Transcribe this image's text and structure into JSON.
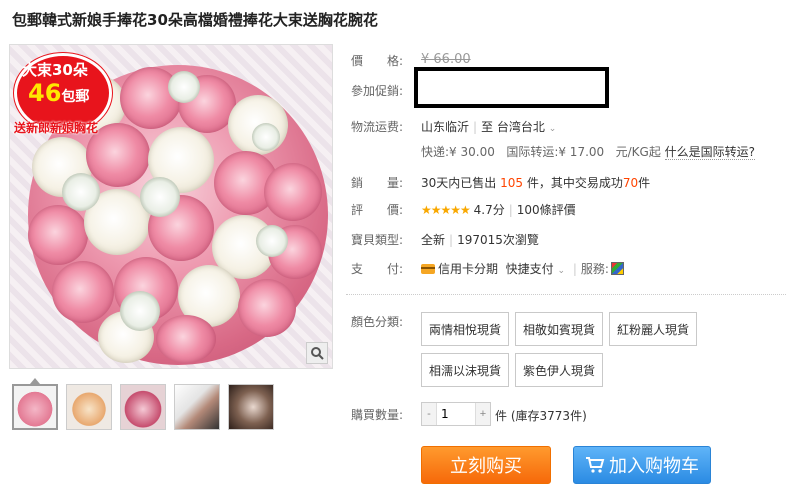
{
  "product": {
    "title": "包郵韓式新娘手捧花30朵高檔婚禮捧花大束送胸花腕花",
    "badge": {
      "line1": "大束30朵",
      "line2_num": "46",
      "line2_unit": "包郵",
      "line3": "送新郎新娘胸花"
    },
    "zoom_icon": "magnifier-icon",
    "thumbnails": [
      "bouquet-thumb-1",
      "bouquet-thumb-2",
      "bouquet-thumb-3",
      "wedding-couple-thumb",
      "couple-portrait-thumb"
    ]
  },
  "info": {
    "price_label": "價　　格:",
    "price_value": "¥ 66.00",
    "promo_label": "參加促銷:",
    "shipping_label": "物流运费:",
    "ship_from": "山东临沂",
    "ship_to_prefix": "至",
    "ship_to": "台湾台北",
    "ship_to_caret": "⌄",
    "express_label": "快递:",
    "express_price": "¥ 30.00",
    "intl_label": "国际转运:",
    "intl_price": "¥ 17.00",
    "intl_unit": "元/KG起",
    "intl_help": "什么是国际转运?",
    "sales_label": "銷　　量:",
    "sales_prefix": "30天内已售出",
    "sales_count": "105",
    "sales_mid": "件，其中交易成功",
    "sales_success": "70",
    "sales_suffix": "件",
    "rating_label": "評　　價:",
    "rating_stars": "★★★★★",
    "rating_score": "4.7分",
    "rating_count": "100條評價",
    "type_label": "寶貝類型:",
    "type_value": "全新",
    "views": "197015次瀏覽",
    "pay_label": "支　　付:",
    "pay_credit": "信用卡分期",
    "pay_quick": "快捷支付",
    "pay_caret": "⌄",
    "service_label": "服務:",
    "color_label": "顏色分類:",
    "color_options": [
      "兩情相悅現貨",
      "相敬如賓現貨",
      "紅粉麗人現貨",
      "相濡以沫現貨",
      "紫色伊人現貨"
    ],
    "qty_label": "購買數量:",
    "qty_minus": "-",
    "qty_plus": "+",
    "qty_value": "1",
    "qty_unit": "件",
    "stock": "(庫存3773件)",
    "buy_now": "立刻购买",
    "add_cart": "加入购物车"
  },
  "colors": {
    "accent_orange": "#f40",
    "buy_button": "#f6690a",
    "cart_button": "#2b8be3",
    "star": "#f9a800"
  }
}
